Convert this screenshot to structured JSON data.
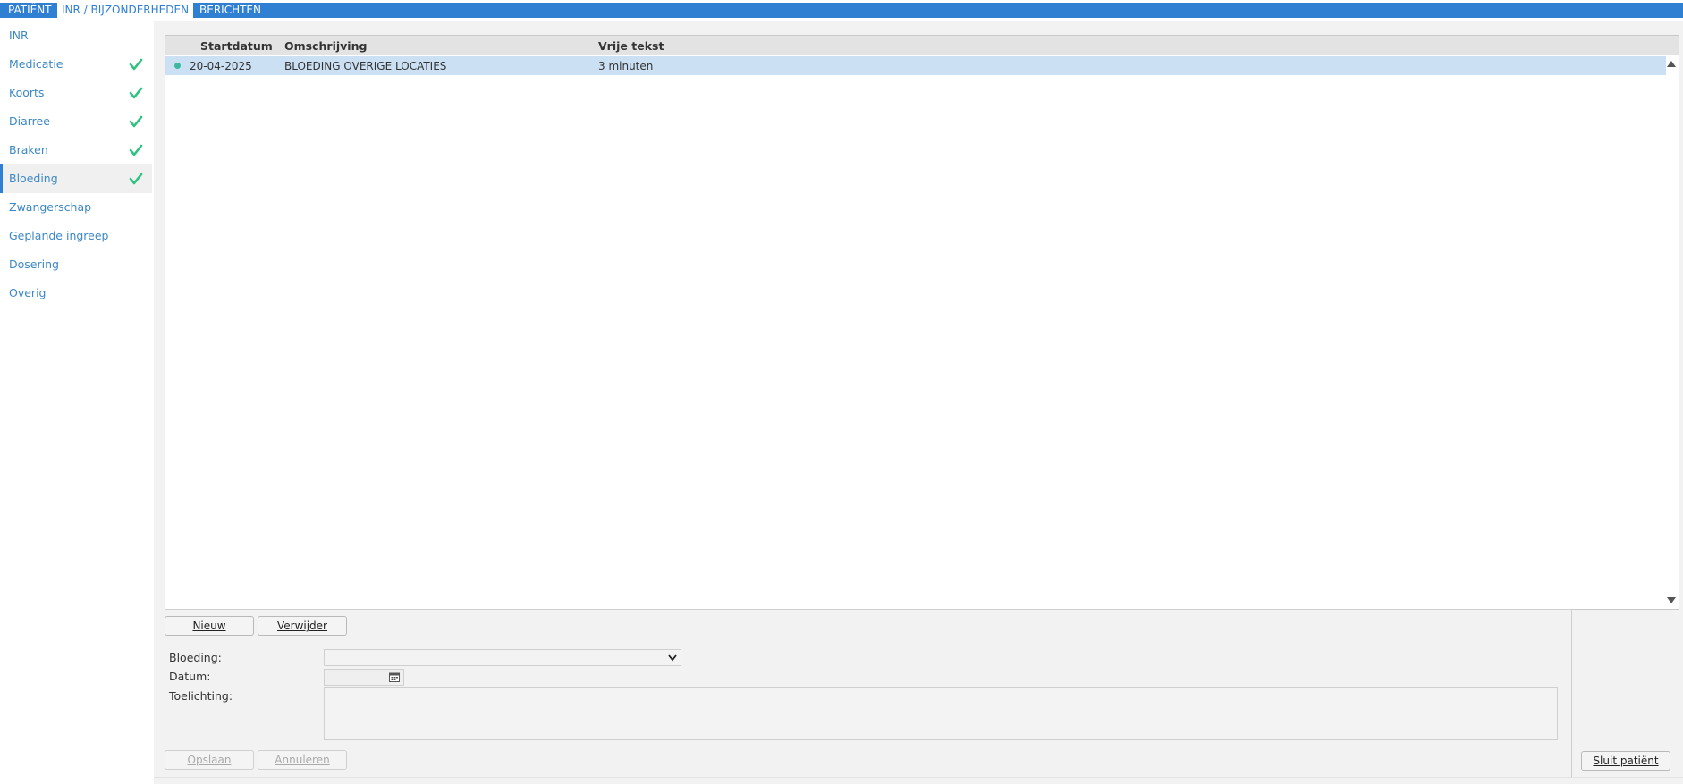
{
  "tabs": [
    {
      "label": "PATIËNT",
      "active": false
    },
    {
      "label": "INR / BIJZONDERHEDEN",
      "active": true
    },
    {
      "label": "BERICHTEN",
      "active": false
    }
  ],
  "sidebar": {
    "items": [
      {
        "label": "INR",
        "checked": false
      },
      {
        "label": "Medicatie",
        "checked": true
      },
      {
        "label": "Koorts",
        "checked": true
      },
      {
        "label": "Diarree",
        "checked": true
      },
      {
        "label": "Braken",
        "checked": true
      },
      {
        "label": "Bloeding",
        "checked": true,
        "active": true
      },
      {
        "label": "Zwangerschap",
        "checked": false
      },
      {
        "label": "Geplande ingreep",
        "checked": false
      },
      {
        "label": "Dosering",
        "checked": false
      },
      {
        "label": "Overig",
        "checked": false
      }
    ]
  },
  "grid": {
    "columns": [
      "Startdatum",
      "Omschrijving",
      "Vrije tekst"
    ],
    "rows": [
      {
        "startdatum": "20-04-2025",
        "omschrijving": "BLOEDING OVERIGE LOCATIES",
        "vrije_tekst": "3 minuten"
      }
    ]
  },
  "actions": {
    "new_label": "Nieuw",
    "delete_label": "Verwijder",
    "save_label": "Opslaan",
    "cancel_label": "Annuleren",
    "close_patient_label": "Sluit patiënt"
  },
  "form": {
    "bloeding_label": "Bloeding:",
    "bloeding_value": "",
    "datum_label": "Datum:",
    "datum_value": "",
    "toelichting_label": "Toelichting:",
    "toelichting_value": ""
  },
  "colors": {
    "accent": "#2f7fd2",
    "link": "#3c88c5",
    "check": "#2ec27e",
    "row_selected": "#cce0f4"
  }
}
